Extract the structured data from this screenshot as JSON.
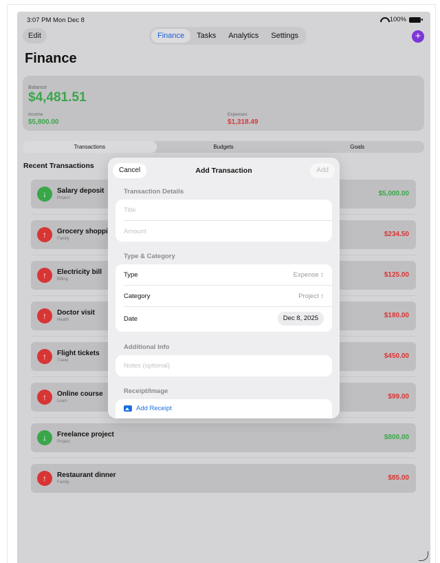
{
  "status": {
    "time": "3:07 PM  Mon Dec 8",
    "battery": "100%"
  },
  "nav": {
    "edit_label": "Edit",
    "tabs": [
      {
        "label": "Finance",
        "active": true
      },
      {
        "label": "Tasks",
        "active": false
      },
      {
        "label": "Analytics",
        "active": false
      },
      {
        "label": "Settings",
        "active": false
      }
    ],
    "add_label": "+"
  },
  "page": {
    "title": "Finance"
  },
  "balance": {
    "label": "Balance",
    "value": "$4,481.51",
    "income_label": "Income",
    "income_value": "$5,800.00",
    "expenses_label": "Expenses",
    "expenses_value": "$1,318.49"
  },
  "segments": [
    {
      "label": "Transactions",
      "active": true
    },
    {
      "label": "Budgets",
      "active": false
    },
    {
      "label": "Goals",
      "active": false
    }
  ],
  "recent": {
    "title": "Recent Transactions",
    "items": [
      {
        "title": "Salary deposit",
        "category": "Project",
        "amount": "$5,000.00",
        "kind": "in"
      },
      {
        "title": "Grocery shopping",
        "category": "Family",
        "amount": "$234.50",
        "kind": "out"
      },
      {
        "title": "Electricity bill",
        "category": "Billing",
        "amount": "$125.00",
        "kind": "out"
      },
      {
        "title": "Doctor visit",
        "category": "Health",
        "amount": "$180.00",
        "kind": "out"
      },
      {
        "title": "Flight tickets",
        "category": "Travel",
        "amount": "$450.00",
        "kind": "out"
      },
      {
        "title": "Online course",
        "category": "Learn",
        "amount": "$99.00",
        "kind": "out"
      },
      {
        "title": "Freelance project",
        "category": "Project",
        "amount": "$800.00",
        "kind": "in"
      },
      {
        "title": "Restaurant dinner",
        "category": "Family",
        "amount": "$85.00",
        "kind": "out"
      }
    ]
  },
  "sheet": {
    "cancel_label": "Cancel",
    "title": "Add Transaction",
    "add_label": "Add",
    "details_header": "Transaction Details",
    "title_placeholder": "Title",
    "amount_placeholder": "Amount",
    "type_header": "Type & Category",
    "type_label": "Type",
    "type_value": "Expense ↕",
    "category_label": "Category",
    "category_value": "Project ↕",
    "date_label": "Date",
    "date_value": "Dec 8, 2025",
    "additional_header": "Additional Info",
    "notes_placeholder": "Notes (optional)",
    "receipt_header": "Receipt/Image",
    "add_receipt_label": "Add Receipt"
  },
  "colors": {
    "accent": "#1a6fe0",
    "income": "#3aa64a",
    "expense": "#d33a3a",
    "add_button": "#7b36d9"
  }
}
